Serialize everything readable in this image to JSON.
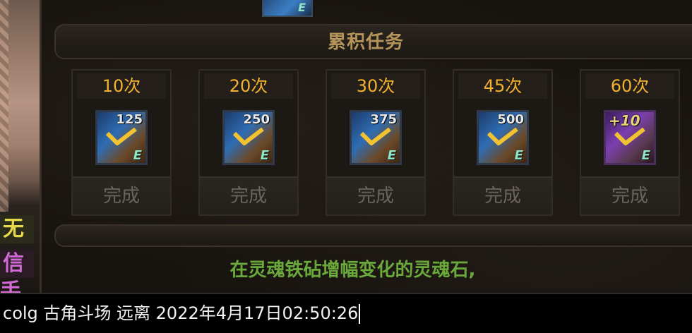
{
  "left_strip": {
    "chip_1": "无",
    "chip_2": "信 手"
  },
  "top_item": {
    "letter": "E"
  },
  "section_title": "累积任务",
  "rewards": [
    {
      "count": "10次",
      "amount": "125",
      "letter": "E",
      "status": "完成",
      "icon": "epic-ticket-blue"
    },
    {
      "count": "20次",
      "amount": "250",
      "letter": "E",
      "status": "完成",
      "icon": "epic-ticket-blue"
    },
    {
      "count": "30次",
      "amount": "375",
      "letter": "E",
      "status": "完成",
      "icon": "epic-ticket-blue"
    },
    {
      "count": "45次",
      "amount": "500",
      "letter": "E",
      "status": "完成",
      "icon": "epic-ticket-blue"
    },
    {
      "count": "60次",
      "amount": "+10",
      "letter": "E",
      "status": "完成",
      "icon": "epic-ticket-purple"
    }
  ],
  "hint_text": "在灵魂铁砧增幅变化的灵魂石,",
  "chat": {
    "value": "colg 古角斗场 远离 2022年4月17日02:50:26"
  },
  "colors": {
    "count_text": "#f2b230",
    "hint_text": "#6aa83c",
    "title_text": "#b5945a",
    "done_text": "#6a645c"
  }
}
